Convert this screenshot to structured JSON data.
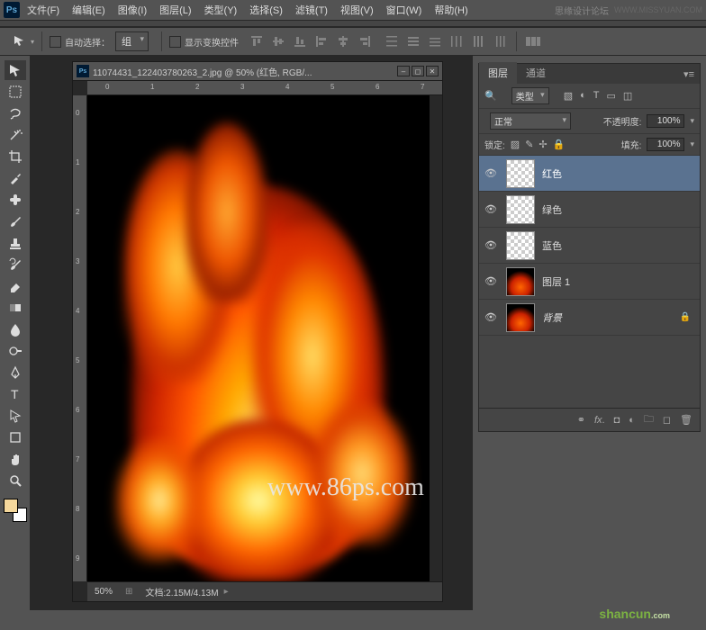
{
  "menu": {
    "items": [
      "文件(F)",
      "编辑(E)",
      "图像(I)",
      "图层(L)",
      "类型(Y)",
      "选择(S)",
      "滤镜(T)",
      "视图(V)",
      "窗口(W)",
      "帮助(H)"
    ],
    "tag": "思缘设计论坛",
    "url": "WWW.MISSYUAN.COM"
  },
  "optbar": {
    "auto": "自动选择：",
    "group": "组",
    "transform": "显示变换控件"
  },
  "doc": {
    "title": "11074431_122403780263_2.jpg @ 50% (红色, RGB/...",
    "zoom": "50%",
    "info": "文档:2.15M/4.13M"
  },
  "rulers": {
    "h": [
      "0",
      "1",
      "2",
      "3",
      "4",
      "5",
      "6",
      "7"
    ],
    "v": [
      "0",
      "1",
      "2",
      "3",
      "4",
      "5",
      "6",
      "7",
      "8",
      "9"
    ]
  },
  "panel": {
    "tabs": [
      "图层",
      "通道"
    ],
    "filter": "类型",
    "blend": "正常",
    "opacity_lbl": "不透明度:",
    "opacity": "100%",
    "fill_lbl": "填充:",
    "fill": "100%",
    "lock": "锁定:"
  },
  "layers": [
    {
      "name": "红色",
      "thumb": "checker",
      "sel": true
    },
    {
      "name": "绿色",
      "thumb": "checker"
    },
    {
      "name": "蓝色",
      "thumb": "checker"
    },
    {
      "name": "图层 1",
      "thumb": "fire"
    },
    {
      "name": "背景",
      "thumb": "fire",
      "locked": true,
      "italic": true
    }
  ],
  "watermark": "www.86ps.com",
  "watermark2": "shancun"
}
